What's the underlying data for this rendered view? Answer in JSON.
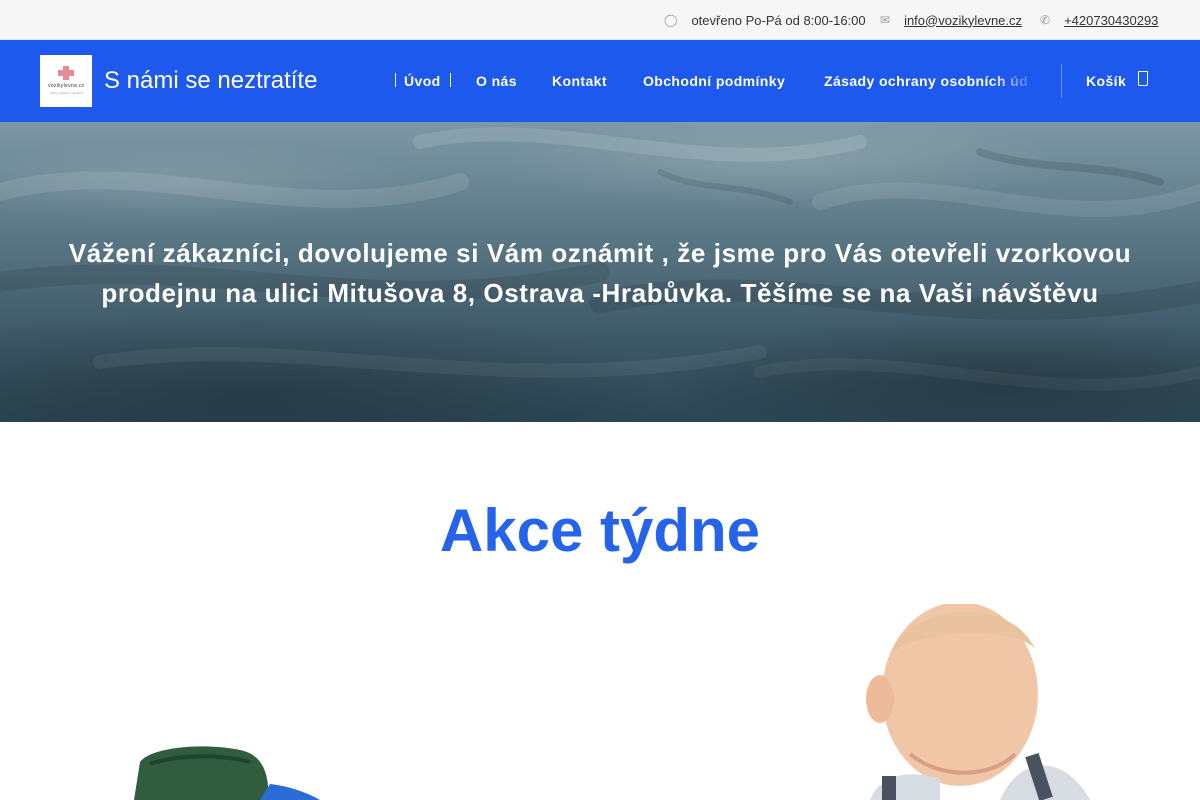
{
  "topbar": {
    "hours": "otevřeno Po-Pá od 8:00-16:00",
    "email": "info@vozikylevne.cz",
    "phone": "+420730430293",
    "icons": [
      "clock-icon",
      "envelope-icon",
      "phone-icon"
    ]
  },
  "header": {
    "site_title": "S námi se neztratíte",
    "logo_text": "vozikylevne.cz",
    "logo_subtext": "vozíky dalších výrobců",
    "background_color": "#1e59ed",
    "nav": [
      {
        "label": "Úvod"
      },
      {
        "label": "O nás"
      },
      {
        "label": "Kontakt"
      },
      {
        "label": "Obchodní podmínky"
      },
      {
        "label": "Zásady ochrany osobních úd"
      }
    ],
    "cart_label": "Košík",
    "cart_icon": "bag-icon"
  },
  "hero": {
    "text": "Vážení zákazníci, dovolujeme si Vám oznámit , že jsme pro Vás otevřeli vzorkovou prodejnu na ulici Mitušova 8, Ostrava -Hrabůvka. Těšíme se na Vaši návštěvu"
  },
  "section": {
    "title": "Akce týdne",
    "title_color": "#2563eb"
  }
}
